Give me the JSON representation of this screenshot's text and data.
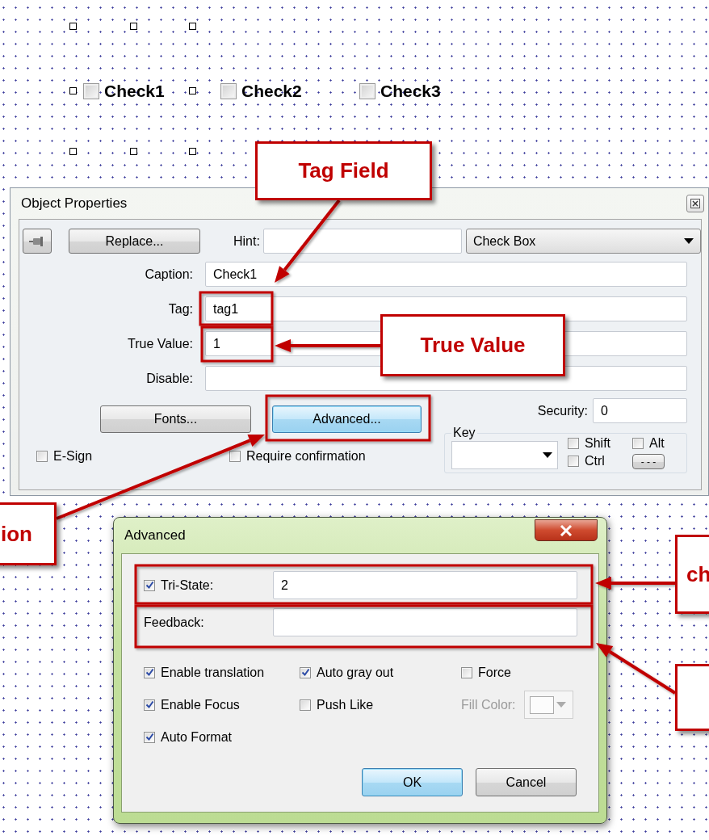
{
  "canvas": {
    "checkboxes": [
      {
        "label": "Check1",
        "checked": false
      },
      {
        "label": "Check2",
        "checked": false
      },
      {
        "label": "Check3",
        "checked": false
      }
    ]
  },
  "object_properties": {
    "title": "Object Properties",
    "replace_button": "Replace...",
    "hint": {
      "label": "Hint:"
    },
    "type_dropdown": {
      "value": "Check Box"
    },
    "fields": [
      {
        "label": "Caption:",
        "value": "Check1"
      },
      {
        "label": "Tag:",
        "value": "tag1"
      },
      {
        "label": "True Value:",
        "value": "1"
      },
      {
        "label": "Disable:"
      }
    ],
    "buttons": [
      {
        "label": "Fonts...",
        "focused": false
      },
      {
        "label": "Advanced...",
        "focused": true
      }
    ],
    "security": {
      "label": "Security:",
      "value": "0"
    },
    "key": {
      "legend": "Key",
      "modifiers": [
        {
          "label": "Shift",
          "checked": false
        },
        {
          "label": "Alt",
          "checked": false
        },
        {
          "label": "Ctrl",
          "checked": false
        }
      ],
      "more_button": "- - -"
    },
    "options": [
      {
        "label": "E-Sign",
        "checked": false
      },
      {
        "label": "Require confirmation",
        "checked": false
      }
    ]
  },
  "advanced": {
    "title": "Advanced",
    "tri_state": {
      "label": "Tri-State:",
      "checked": true,
      "value": "2"
    },
    "feedback": {
      "label": "Feedback:"
    },
    "options": [
      {
        "kind": "checkbox",
        "label": "Enable translation",
        "checked": true
      },
      {
        "kind": "checkbox",
        "label": "Auto gray out",
        "checked": true
      },
      {
        "kind": "checkbox",
        "label": "Force",
        "checked": false
      },
      {
        "kind": "checkbox",
        "label": "Enable Focus",
        "checked": true
      },
      {
        "kind": "checkbox",
        "label": "Push Like",
        "checked": false
      },
      {
        "kind": "color",
        "label": "Fill Color:",
        "disabled": true
      },
      {
        "kind": "checkbox",
        "label": "Auto Format",
        "checked": true
      }
    ],
    "buttons": [
      {
        "label": "OK",
        "focused": true
      },
      {
        "label": "Cancel",
        "focused": false
      }
    ]
  },
  "callouts": [
    {
      "kind": "text",
      "text": "Tag Field"
    },
    {
      "kind": "text",
      "text": "True Value"
    },
    {
      "kind": "text",
      "text": "ion"
    },
    {
      "kind": "text",
      "text": "ch"
    },
    {
      "kind": "blank"
    }
  ]
}
